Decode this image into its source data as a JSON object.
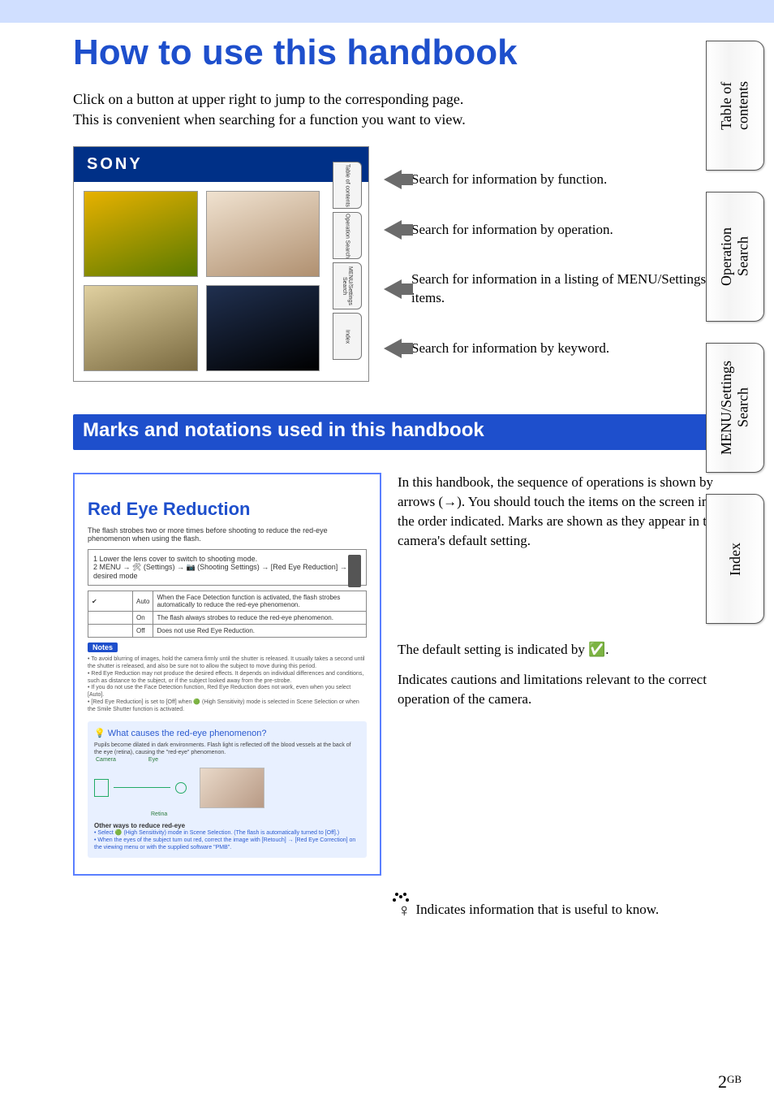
{
  "header": {
    "main_title": "How to use this handbook",
    "intro_line1": "Click on a button at upper right to jump to the corresponding page.",
    "intro_line2": "This is convenient when searching for a function you want to view."
  },
  "screenshot": {
    "brand": "SONY",
    "tabs": [
      "Table of contents",
      "Operation Search",
      "MENU/Settings Search",
      "Index"
    ]
  },
  "screenshot_annotations": [
    "Search for information by function.",
    "Search for information by operation.",
    "Search for information in a listing of MENU/Settings items.",
    "Search for information by keyword."
  ],
  "section": {
    "title": "Marks and notations used in this handbook"
  },
  "example": {
    "title": "Red Eye Reduction",
    "subtitle": "The flash strobes two or more times before shooting to reduce the red-eye phenomenon when using the flash.",
    "step1": "1  Lower the lens cover to switch to shooting mode.",
    "step2": "2  MENU → 🛠 (Settings) → 📷 (Shooting Settings) → [Red Eye Reduction] → desired mode",
    "table": {
      "rows": [
        {
          "mode": "Auto",
          "desc": "When the Face Detection function is activated, the flash strobes automatically to reduce the red-eye phenomenon.",
          "check": true
        },
        {
          "mode": "On",
          "desc": "The flash always strobes to reduce the red-eye phenomenon."
        },
        {
          "mode": "Off",
          "desc": "Does not use Red Eye Reduction."
        }
      ]
    },
    "notes_label": "Notes",
    "notes_bullets": "• To avoid blurring of images, hold the camera firmly until the shutter is released. It usually takes a second until the shutter is released, and also be sure not to allow the subject to move during this period.\n• Red Eye Reduction may not produce the desired effects. It depends on individual differences and conditions, such as distance to the subject, or if the subject looked away from the pre-strobe.\n• If you do not use the Face Detection function, Red Eye Reduction does not work, even when you select [Auto].\n• [Red Eye Reduction] is set to [Off] when 🟢 (High Sensitivity) mode is selected in Scene Selection or when the Smile Shutter function is activated.",
    "tip_title": "What causes the red-eye phenomenon?",
    "tip_body": "Pupils become dilated in dark environments. Flash light is reflected off the blood vessels at the back of the eye (retina), causing the \"red-eye\" phenomenon.",
    "retina_labels": {
      "camera": "Camera",
      "eye": "Eye",
      "retina": "Retina"
    },
    "other_ways_title": "Other ways to reduce red-eye",
    "other_ways_body": "• Select 🟢 (High Sensitivity) mode in Scene Selection. (The flash is automatically turned to [Off].)\n• When the eyes of the subject turn out red, correct the image with [Retouch] → [Red Eye Correction] on the viewing menu or with the supplied software \"PMB\"."
  },
  "marks_annotations": {
    "sequence": "In this handbook, the sequence of operations is shown by arrows (→). You should touch the items on the screen in the order indicated. Marks are shown as they appear in the camera's default setting.",
    "default_setting_pre": "The default setting is indicated by ",
    "default_setting_mark": "✅",
    "default_setting_post": ".",
    "cautions": "Indicates cautions and limitations relevant to the correct operation of the camera.",
    "tip": "Indicates information that is useful to know."
  },
  "side_tabs": [
    "Table of\ncontents",
    "Operation\nSearch",
    "MENU/Settings\nSearch",
    "Index"
  ],
  "page_number": {
    "num": "2",
    "suffix": "GB"
  }
}
